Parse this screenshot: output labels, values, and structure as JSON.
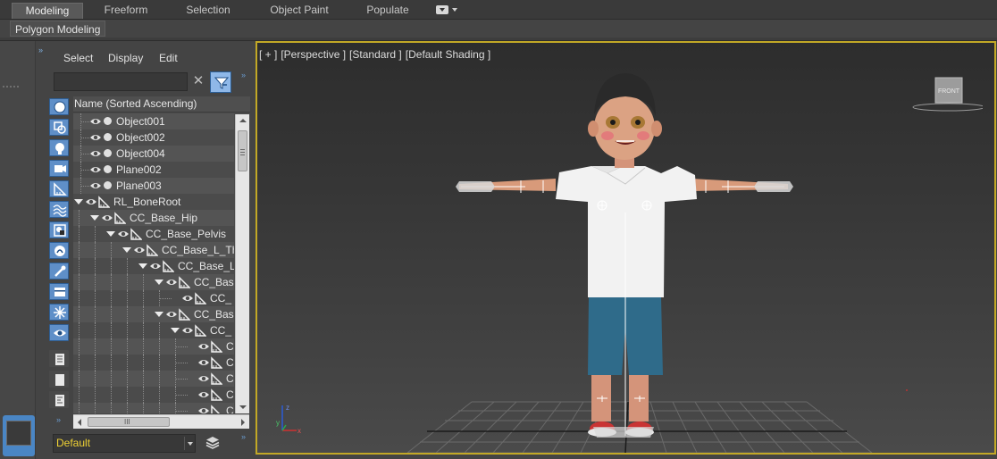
{
  "ribbon": {
    "tabs": [
      "Modeling",
      "Freeform",
      "Selection",
      "Object Paint",
      "Populate"
    ],
    "active_tab": "Modeling",
    "panel_label": "Polygon Modeling"
  },
  "explorer": {
    "menu": [
      "Select",
      "Display",
      "Edit"
    ],
    "search_value": "",
    "column_header": "Name (Sorted Ascending)",
    "layer_value": "Default",
    "expand_glyph": "»",
    "scrollbar_grip": "III",
    "clear_glyph": "✕",
    "filter_icons": [
      "geometry-filter-icon",
      "shapes-filter-icon",
      "lights-filter-icon",
      "cameras-filter-icon",
      "helpers-filter-icon",
      "spacewarps-filter-icon",
      "groups-filter-icon",
      "xrefs-filter-icon",
      "bones-filter-icon",
      "containers-filter-icon",
      "frozen-filter-icon",
      "hidden-filter-icon",
      "display-all-icon",
      "display-none-icon",
      "invert-display-icon"
    ],
    "rows": [
      {
        "label": "Object001",
        "level": 0,
        "type": "object",
        "expanded": false
      },
      {
        "label": "Object002",
        "level": 0,
        "type": "object",
        "expanded": false
      },
      {
        "label": "Object004",
        "level": 0,
        "type": "object",
        "expanded": false
      },
      {
        "label": "Plane002",
        "level": 0,
        "type": "object",
        "expanded": false
      },
      {
        "label": "Plane003",
        "level": 0,
        "type": "object",
        "expanded": false
      },
      {
        "label": "RL_BoneRoot",
        "level": 0,
        "type": "bone",
        "expanded": true
      },
      {
        "label": "CC_Base_Hip",
        "level": 1,
        "type": "bone",
        "expanded": true
      },
      {
        "label": "CC_Base_Pelvis",
        "level": 2,
        "type": "bone",
        "expanded": true
      },
      {
        "label": "CC_Base_L_Thi",
        "level": 3,
        "type": "bone",
        "expanded": true
      },
      {
        "label": "CC_Base_L",
        "level": 4,
        "type": "bone",
        "expanded": true
      },
      {
        "label": "CC_Base",
        "level": 5,
        "type": "bone",
        "expanded": true
      },
      {
        "label": "CC_",
        "level": 6,
        "type": "bone",
        "expanded": false
      },
      {
        "label": "CC_Base",
        "level": 5,
        "type": "bone",
        "expanded": true
      },
      {
        "label": "CC_",
        "level": 6,
        "type": "bone",
        "expanded": true
      },
      {
        "label": "C",
        "level": 7,
        "type": "bone",
        "expanded": false
      },
      {
        "label": "C",
        "level": 7,
        "type": "bone",
        "expanded": false
      },
      {
        "label": "C",
        "level": 7,
        "type": "bone",
        "expanded": false
      },
      {
        "label": "C",
        "level": 7,
        "type": "bone",
        "expanded": false
      },
      {
        "label": "C",
        "level": 7,
        "type": "bone",
        "expanded": false
      }
    ]
  },
  "viewport": {
    "label_parts": [
      "[ + ]",
      "[Perspective ]",
      "[Standard ]",
      "[Default Shading ]"
    ],
    "viewcube_face": "FRONT",
    "active_border_color": "#c2a826",
    "axes": {
      "x": "x",
      "y": "y",
      "z": "z"
    }
  },
  "colors": {
    "accent_blue": "#5f8fc8",
    "layer_text": "#f0d234",
    "shirt": "#f2f2f2",
    "shorts": "#2f6b8a",
    "skin": "#d89a7a",
    "hair": "#2a2a2a"
  }
}
